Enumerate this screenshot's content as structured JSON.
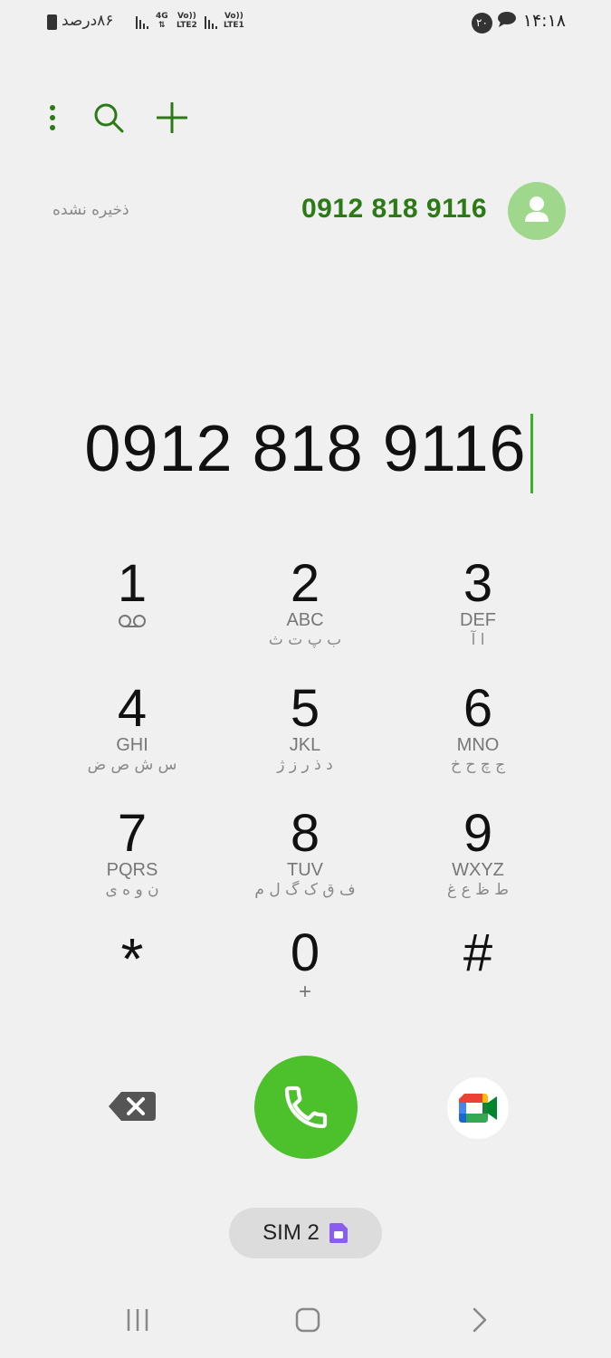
{
  "status_bar": {
    "time": "۱۴:۱۸",
    "notification_count": "۲۰",
    "battery_text": "۸۶درصد",
    "sim2_network": "4G",
    "sim2_volte": "Vo))",
    "sim2_lte": "LTE2",
    "sim1_volte": "Vo))",
    "sim1_lte": "LTE1"
  },
  "toolbar": {
    "more_icon": "more-vertical-icon",
    "search_icon": "search-icon",
    "add_icon": "plus-icon"
  },
  "contact_suggestion": {
    "number": "0912 818 9116",
    "status_label": "ذخیره نشده"
  },
  "dialer": {
    "entered_number": "0912 818 9116"
  },
  "keypad": {
    "keys": [
      {
        "digit": "1",
        "latin": "",
        "persian": "",
        "sub_icon": "voicemail-icon"
      },
      {
        "digit": "2",
        "latin": "ABC",
        "persian": "ب پ ت ث"
      },
      {
        "digit": "3",
        "latin": "DEF",
        "persian": "ا آ"
      },
      {
        "digit": "4",
        "latin": "GHI",
        "persian": "س ش ص ض"
      },
      {
        "digit": "5",
        "latin": "JKL",
        "persian": "د ذ ر ز ژ"
      },
      {
        "digit": "6",
        "latin": "MNO",
        "persian": "ج چ ح خ"
      },
      {
        "digit": "7",
        "latin": "PQRS",
        "persian": "ن و ه ی"
      },
      {
        "digit": "8",
        "latin": "TUV",
        "persian": "ف ق ک گ ل م"
      },
      {
        "digit": "9",
        "latin": "WXYZ",
        "persian": "ط ظ ع غ"
      },
      {
        "digit": "*",
        "latin": "",
        "persian": ""
      },
      {
        "digit": "0",
        "latin": "+",
        "persian": ""
      },
      {
        "digit": "#",
        "latin": "",
        "persian": ""
      }
    ]
  },
  "actions": {
    "backspace_icon": "backspace-icon",
    "call_icon": "phone-icon",
    "video_icon": "google-meet-icon",
    "sim_label": "SIM 2"
  },
  "colors": {
    "accent_green": "#2c7a16",
    "call_green": "#4cc12c",
    "avatar_green": "#9fd88c",
    "cursor_green": "#3db02a",
    "sim_purple": "#8a5cf0"
  },
  "nav": {
    "recents_icon": "recents-icon",
    "home_icon": "home-icon",
    "back_icon": "back-icon"
  }
}
